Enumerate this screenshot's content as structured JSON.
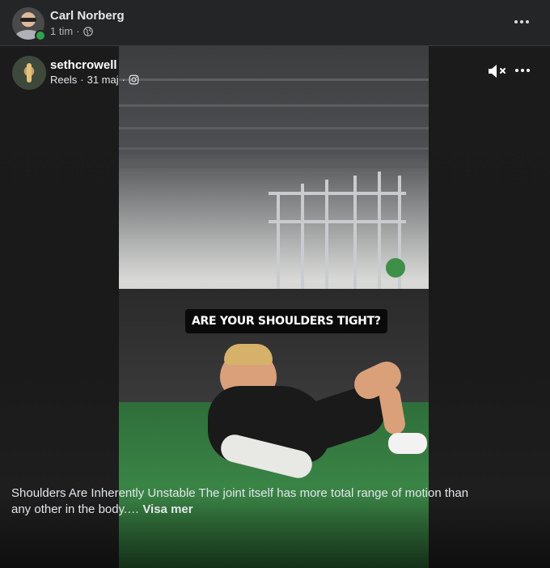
{
  "post": {
    "author": "Carl Norberg",
    "time": "1 tim",
    "separator": "·",
    "privacy_icon": "globe-icon"
  },
  "reel": {
    "author": "sethcrowell",
    "source": "Reels",
    "date": "31 maj",
    "separator": "·",
    "platform_icon": "instagram-icon",
    "overlay_text": "ARE YOUR SHOULDERS TIGHT?",
    "mute_icon": "speaker-muted-icon",
    "caption": "Shoulders Are Inherently Unstable The joint itself has more total range of motion than any other in the body.…",
    "see_more": "Visa mer"
  },
  "colors": {
    "background": "#242526",
    "online": "#31a24c",
    "text": "#e4e6eb",
    "secondary_text": "#b0b3b8",
    "mat_green": "#3a8446"
  }
}
